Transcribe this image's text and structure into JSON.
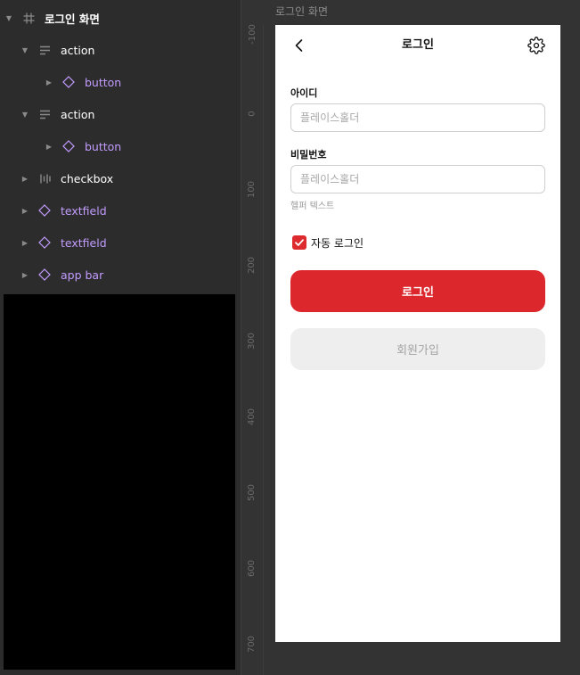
{
  "layers": {
    "items": [
      {
        "label": "로그인 화면",
        "icon": "frame-icon"
      },
      {
        "label": "action",
        "icon": "auto-layout-vertical-icon"
      },
      {
        "label": "button",
        "icon": "component-instance-icon"
      },
      {
        "label": "action",
        "icon": "auto-layout-vertical-icon"
      },
      {
        "label": "button",
        "icon": "component-instance-icon"
      },
      {
        "label": "checkbox",
        "icon": "auto-layout-horizontal-icon"
      },
      {
        "label": "textfield",
        "icon": "component-instance-icon"
      },
      {
        "label": "textfield",
        "icon": "component-instance-icon"
      },
      {
        "label": "app bar",
        "icon": "component-instance-icon"
      }
    ]
  },
  "canvas": {
    "frame_label": "로그인 화면",
    "ruler_ticks": [
      "-100",
      "0",
      "100",
      "200",
      "300",
      "400",
      "500",
      "600",
      "700"
    ]
  },
  "phone": {
    "appbar": {
      "title": "로그인",
      "left_icon": "chevron-left-icon",
      "right_icon": "gear-icon"
    },
    "id_field": {
      "label": "아이디",
      "placeholder": "플레이스홀더",
      "value": ""
    },
    "password_field": {
      "label": "비밀번호",
      "placeholder": "플레이스홀더",
      "value": "",
      "helper": "헬퍼 텍스트"
    },
    "auto_login": {
      "label": "자동 로그인",
      "checked": true
    },
    "login_button": {
      "label": "로그인"
    },
    "signup_button": {
      "label": "회원가입"
    }
  },
  "colors": {
    "accent": "#dc282d",
    "layer_component": "#c29cff",
    "panel_bg": "#2c2c2c",
    "canvas_bg": "#333333"
  }
}
